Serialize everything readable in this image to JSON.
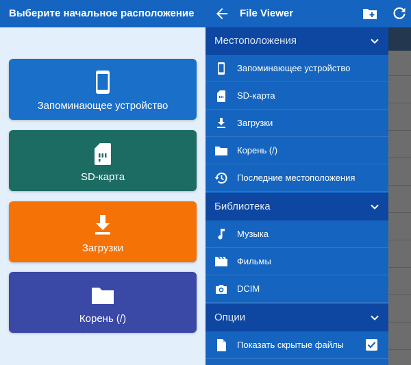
{
  "left_panel": {
    "title": "Выберите начальное расположение",
    "cards": [
      {
        "label": "Запоминающее устройство",
        "icon": "phone-icon",
        "color": "#1a6fc9"
      },
      {
        "label": "SD-карта",
        "icon": "sd-card-icon",
        "color": "#1c6c63"
      },
      {
        "label": "Загрузки",
        "icon": "download-icon",
        "color": "#f57206"
      },
      {
        "label": "Корень (/)",
        "icon": "folder-icon",
        "color": "#3a48a6"
      }
    ]
  },
  "drawer": {
    "title": "File Viewer",
    "sections": [
      {
        "title": "Местоположения",
        "items": [
          {
            "label": "Запоминающее устройство",
            "icon": "phone-icon"
          },
          {
            "label": "SD-карта",
            "icon": "sd-card-icon"
          },
          {
            "label": "Загрузки",
            "icon": "download-icon"
          },
          {
            "label": "Корень (/)",
            "icon": "folder-icon"
          },
          {
            "label": "Последние местоположения",
            "icon": "history-icon"
          }
        ]
      },
      {
        "title": "Библиотека",
        "items": [
          {
            "label": "Музыка",
            "icon": "music-icon"
          },
          {
            "label": "Фильмы",
            "icon": "movie-icon"
          },
          {
            "label": "DCIM",
            "icon": "camera-icon"
          }
        ]
      },
      {
        "title": "Опции",
        "items": [
          {
            "label": "Показать скрытые файлы",
            "icon": "file-icon",
            "checked": true
          }
        ]
      }
    ]
  },
  "colors": {
    "primary": "#1565c0",
    "section_header": "#0d47a1",
    "left_background": "#e3f0fb"
  }
}
